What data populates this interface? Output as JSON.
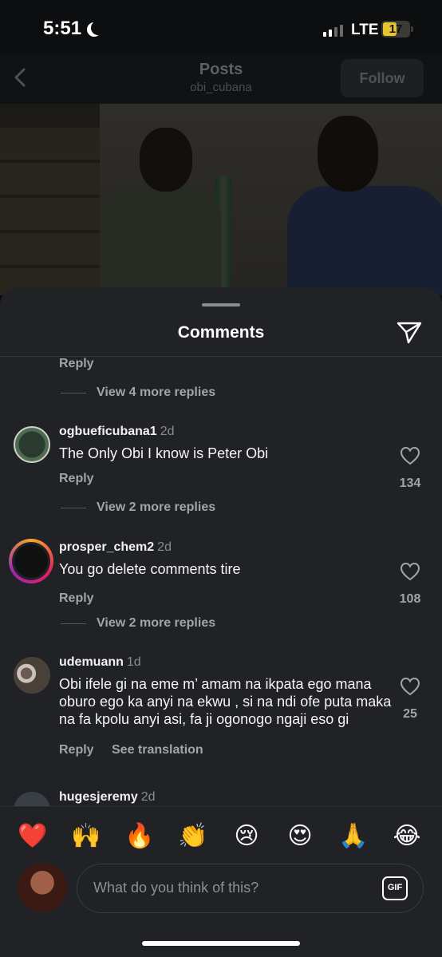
{
  "status": {
    "time": "5:51",
    "network": "LTE",
    "battery": "17"
  },
  "header": {
    "title": "Posts",
    "username": "obi_cubana",
    "follow_label": "Follow"
  },
  "sheet": {
    "title": "Comments"
  },
  "partial": {
    "reply_label": "Reply",
    "more_replies": "View 4 more replies"
  },
  "comments": [
    {
      "username": "ogbueficubana1",
      "time": "2d",
      "text": "The Only Obi I know is Peter Obi",
      "reply_label": "Reply",
      "likes": "134",
      "more_replies": "View 2 more replies"
    },
    {
      "username": "prosper_chem2",
      "time": "2d",
      "text": "You go delete comments tire",
      "reply_label": "Reply",
      "likes": "108",
      "more_replies": "View 2 more replies"
    },
    {
      "username": "udemuann",
      "time": "1d",
      "text": "Obi ifele gi na eme m’ amam na ikpata ego mana oburo ego ka anyi na ekwu , si na ndi ofe puta maka na fa kpolu anyi asi, fa ji ogonogo ngaji eso gi",
      "reply_label": "Reply",
      "translate_label": "See translation",
      "likes": "25"
    },
    {
      "username": "hugesjeremy",
      "time": "2d"
    }
  ],
  "emojis": [
    "❤️",
    "🙌",
    "🔥",
    "👏",
    "😢",
    "😍",
    "🙏",
    "😂"
  ],
  "input": {
    "placeholder": "What do you think of this?",
    "gif_label": "GIF"
  }
}
